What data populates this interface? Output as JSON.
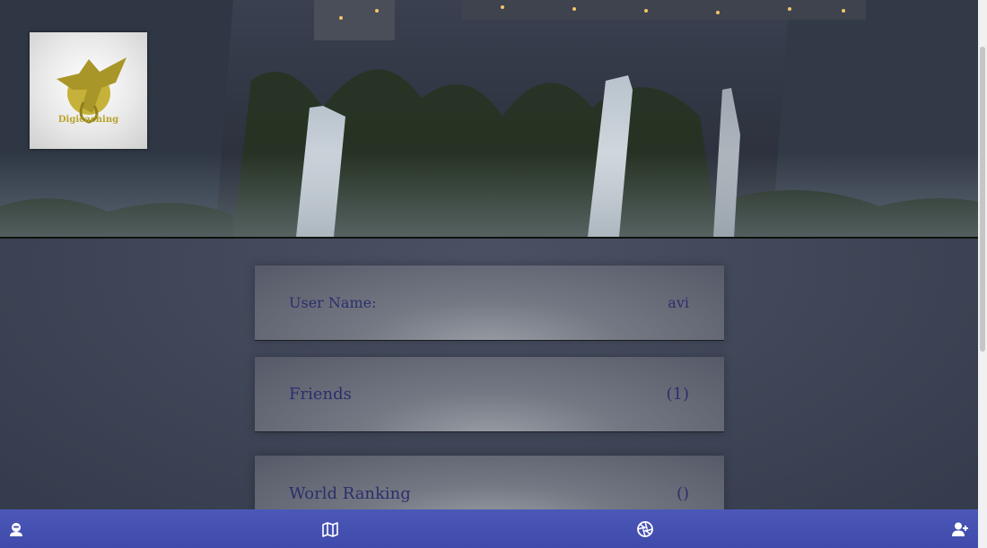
{
  "header": {
    "logo_text": "Digicaching"
  },
  "profile": {
    "username_label": "User Name:",
    "username_value": "avi",
    "friends_label": "Friends",
    "friends_value": "(1)",
    "ranking_label": "World Ranking",
    "ranking_value": "()"
  },
  "bottom_nav": {
    "items": [
      {
        "icon": "user-icon"
      },
      {
        "icon": "map-icon"
      },
      {
        "icon": "camera-aperture-icon"
      },
      {
        "icon": "add-user-icon"
      }
    ]
  },
  "colors": {
    "nav_bg": "#4450b0",
    "card_text": "#2b2f6b",
    "page_bg": "#3d4456"
  }
}
